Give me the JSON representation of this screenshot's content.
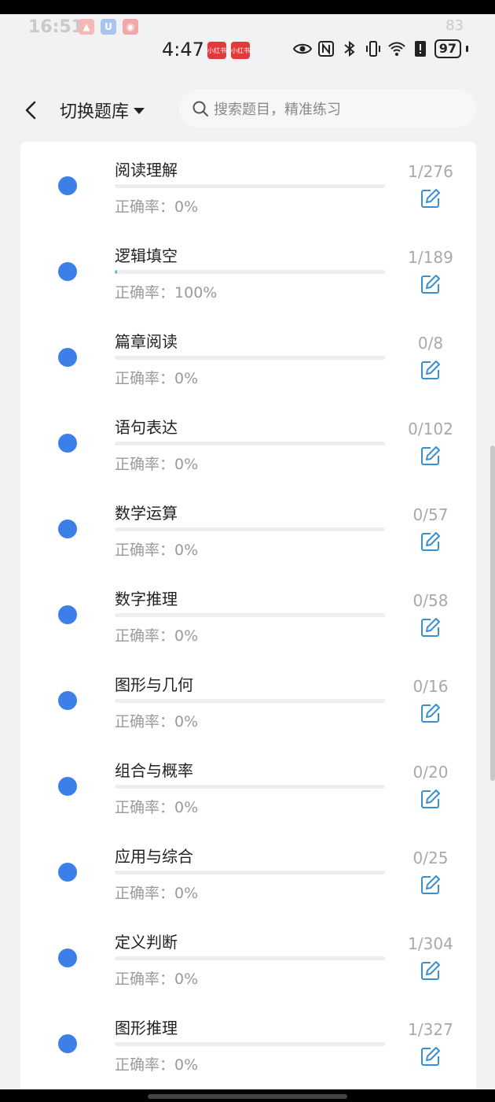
{
  "status_ghost": {
    "time": "16:51",
    "battery": "83"
  },
  "status": {
    "time": "4:47",
    "battery": "97",
    "app_badge": "小红书"
  },
  "header": {
    "title": "切换题库",
    "search_placeholder": "搜索题目，精准练习"
  },
  "accuracy_label": "正确率：",
  "rows": [
    {
      "name": "阅读理解",
      "accuracy": "0%",
      "count": "1/276",
      "progress": 0
    },
    {
      "name": "逻辑填空",
      "accuracy": "100%",
      "count": "1/189",
      "progress": 0.005
    },
    {
      "name": "篇章阅读",
      "accuracy": "0%",
      "count": "0/8",
      "progress": 0
    },
    {
      "name": "语句表达",
      "accuracy": "0%",
      "count": "0/102",
      "progress": 0
    },
    {
      "name": "数学运算",
      "accuracy": "0%",
      "count": "0/57",
      "progress": 0
    },
    {
      "name": "数字推理",
      "accuracy": "0%",
      "count": "0/58",
      "progress": 0
    },
    {
      "name": "图形与几何",
      "accuracy": "0%",
      "count": "0/16",
      "progress": 0
    },
    {
      "name": "组合与概率",
      "accuracy": "0%",
      "count": "0/20",
      "progress": 0
    },
    {
      "name": "应用与综合",
      "accuracy": "0%",
      "count": "0/25",
      "progress": 0
    },
    {
      "name": "定义判断",
      "accuracy": "0%",
      "count": "1/304",
      "progress": 0
    },
    {
      "name": "图形推理",
      "accuracy": "0%",
      "count": "1/327",
      "progress": 0
    }
  ],
  "colors": {
    "dot": "#3d7fe8",
    "progress": "#67b8d6",
    "edit_icon": "#3a8fd0"
  }
}
